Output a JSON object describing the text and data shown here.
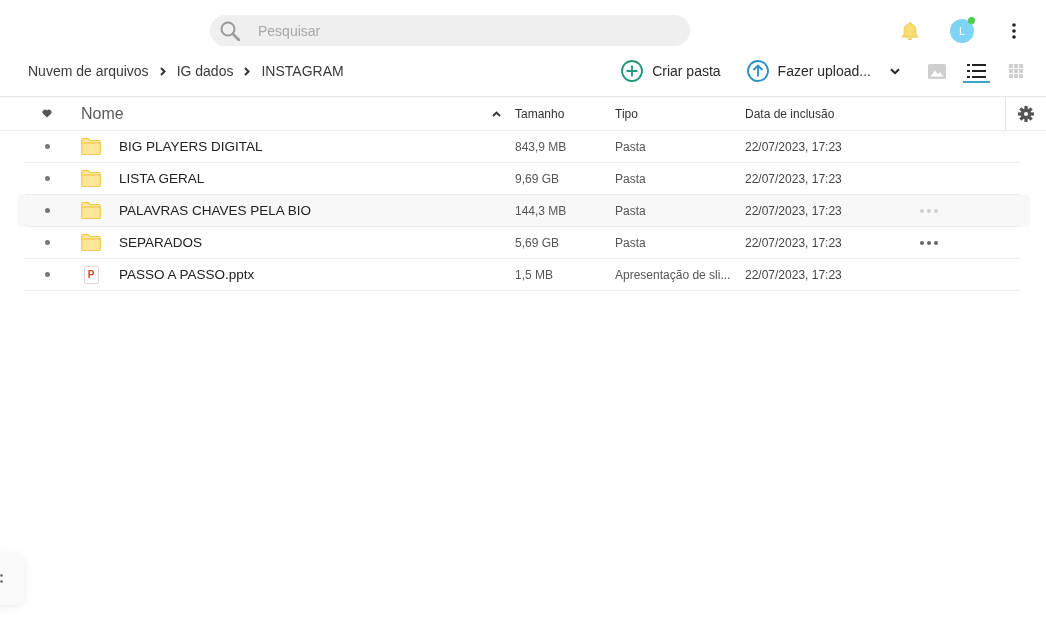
{
  "search": {
    "placeholder": "Pesquisar"
  },
  "avatar": {
    "initial": "L",
    "online": true
  },
  "breadcrumb": [
    {
      "label": "Nuvem de arquivos"
    },
    {
      "label": "IG dados"
    },
    {
      "label": "INSTAGRAM"
    }
  ],
  "actions": [
    {
      "kind": "create",
      "label": "Criar pasta",
      "has_menu": false
    },
    {
      "kind": "upload",
      "label": "Fazer upload...",
      "has_menu": true
    }
  ],
  "views": [
    {
      "kind": "gallery",
      "selected": false
    },
    {
      "kind": "list",
      "selected": true
    },
    {
      "kind": "grid",
      "selected": false
    }
  ],
  "table": {
    "columns": [
      {
        "label": "Nome",
        "sorted": true
      },
      {
        "label": "Tamanho",
        "sorted": false
      },
      {
        "label": "Tipo",
        "sorted": false
      },
      {
        "label": "Data de inclusão",
        "sorted": false
      }
    ],
    "rows": [
      {
        "kind": "folder",
        "name": "BIG PLAYERS DIGITAL",
        "size": "843,9 MB",
        "type": "Pasta",
        "date": "22/07/2023, 17:23",
        "favorite": false,
        "highlighted": false
      },
      {
        "kind": "folder",
        "name": "LISTA GERAL",
        "size": "9,69 GB",
        "type": "Pasta",
        "date": "22/07/2023, 17:23",
        "favorite": false,
        "highlighted": false
      },
      {
        "kind": "folder",
        "name": "PALAVRAS CHAVES PELA BIO",
        "size": "144,3 MB",
        "type": "Pasta",
        "date": "22/07/2023, 17:23",
        "favorite": false,
        "highlighted": true,
        "more_button": {
          "dimmed": true
        }
      },
      {
        "kind": "folder",
        "name": "SEPARADOS",
        "size": "5,69 GB",
        "type": "Pasta",
        "date": "22/07/2023, 17:23",
        "favorite": false,
        "highlighted": false,
        "more_button": {
          "dimmed": false
        }
      },
      {
        "kind": "presentation",
        "icon_text": "P",
        "name": "PASSO A PASSO.pptx",
        "size": "1,5 MB",
        "type": "Apresentação de sli...",
        "date": "22/07/2023, 17:23",
        "favorite": false,
        "highlighted": false
      }
    ]
  }
}
